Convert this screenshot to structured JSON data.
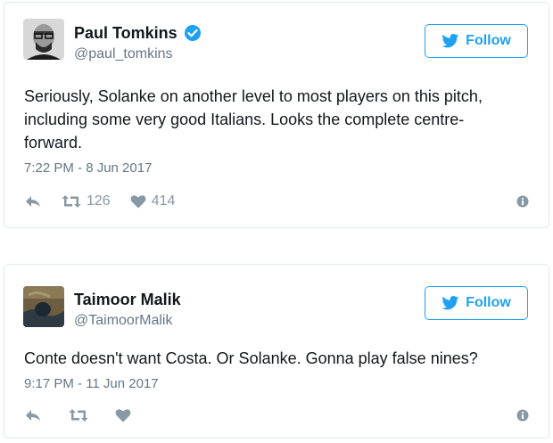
{
  "tweets": [
    {
      "name": "Paul Tomkins",
      "verified": true,
      "handle": "@paul_tomkins",
      "follow_label": "Follow",
      "text": "Seriously, Solanke on another level to most players on this pitch,\nincluding some very good Italians. Looks the complete centre-\nforward.",
      "timestamp": "7:22 PM - 8 Jun 2017",
      "retweets": "126",
      "likes": "414",
      "icons": [
        "reply-icon",
        "retweet-icon",
        "heart-icon",
        "info-icon"
      ]
    },
    {
      "name": "Taimoor Malik",
      "verified": false,
      "handle": "@TaimoorMalik",
      "follow_label": "Follow",
      "text": "Conte doesn't want Costa. Or Solanke. Gonna play false nines?",
      "timestamp": "9:17 PM - 11 Jun 2017",
      "retweets": "",
      "likes": "",
      "icons": [
        "reply-icon",
        "retweet-icon",
        "heart-icon",
        "info-icon"
      ]
    }
  ],
  "colors": {
    "accent": "#1da1f2",
    "text": "#14171a",
    "secondary": "#657786",
    "action": "#8899a6",
    "border": "#e1e8ed"
  }
}
